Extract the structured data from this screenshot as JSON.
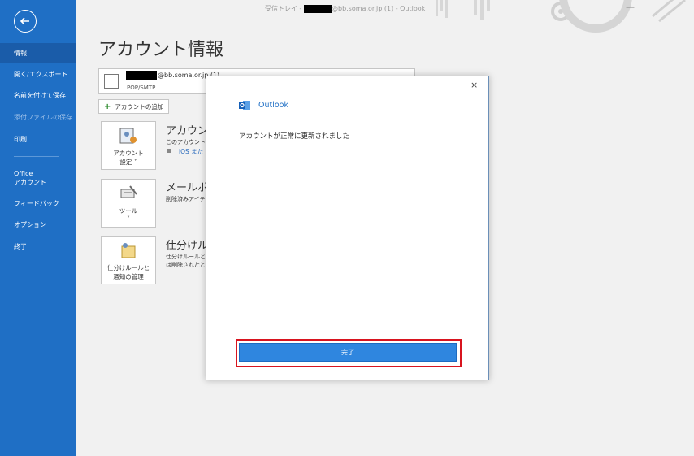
{
  "window": {
    "title_prefix": "受信トレイ - ",
    "title_suffix": "@bb.soma.or.jp (1)  -  Outlook"
  },
  "sidebar": {
    "items": [
      {
        "label": "情報"
      },
      {
        "label": "開く/エクスポート"
      },
      {
        "label": "名前を付けて保存"
      },
      {
        "label": "添付ファイルの保存"
      },
      {
        "label": "印刷"
      },
      {
        "label_line1": "Office",
        "label_line2": "アカウント"
      },
      {
        "label": "フィードバック"
      },
      {
        "label": "オプション"
      },
      {
        "label": "終了"
      }
    ]
  },
  "main": {
    "page_title": "アカウント情報",
    "account": {
      "email_suffix": "@bb.soma.or.jp (1)",
      "type": "POP/SMTP"
    },
    "add_account_label": "アカウントの追加",
    "sections": [
      {
        "button_line1": "アカウント",
        "button_line2": "設定 ˅",
        "title": "アカウント",
        "desc": "このアカウントの",
        "link": "iOS また"
      },
      {
        "button_line1": "ツール",
        "button_line2": "˅",
        "title": "メールボッ",
        "desc": "削除済みアイテ"
      },
      {
        "button_line1": "仕分けルールと",
        "button_line2": "通知の管理",
        "title": "仕分けル",
        "desc_line1": "仕分けルールと",
        "desc_line2": "は削除されたと"
      }
    ]
  },
  "dialog": {
    "close_glyph": "×",
    "app_name": "Outlook",
    "message": "アカウントが正常に更新されました",
    "done_label": "完了"
  },
  "colors": {
    "sidebar": "#1f6fc5",
    "primary_button": "#2f86df",
    "highlight": "#d8141f"
  }
}
